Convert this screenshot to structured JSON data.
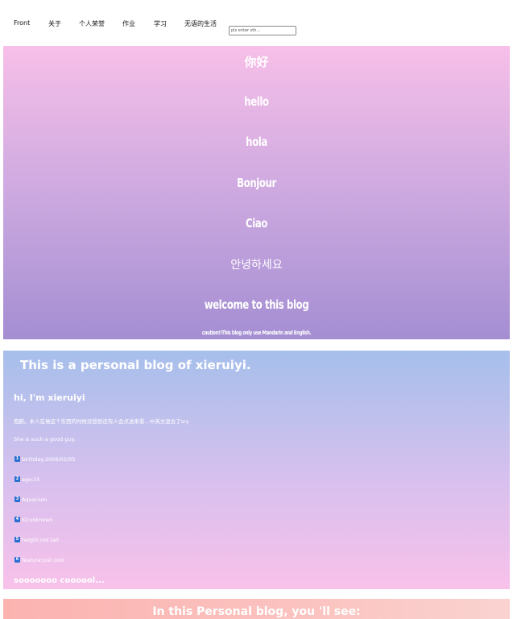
{
  "nav": {
    "items": [
      "Front",
      "关于",
      "个人荣誉",
      "作业",
      "学习",
      "无语的生活"
    ],
    "search_placeholder": "pls enter sth..."
  },
  "hero": {
    "greetings": [
      "你好",
      "hello",
      "hola",
      "Bonjour",
      "Ciao",
      "안녕하세요"
    ],
    "welcome": "welcome to this blog",
    "caution": "caution!!This blog only use Mandarin and English."
  },
  "intro": {
    "title": "This is a personal blog of xieruiyi.",
    "hi": "hi, I'm xieruiyi",
    "note": "抱歉。本人在做这个东西的时候没想到还有人会点进来看...中英文混合了sry",
    "line": "She is such a good guy.",
    "facts": [
      {
        "num": "1",
        "text": "birthday:2006/02/05"
      },
      {
        "num": "2",
        "text": "age:15"
      },
      {
        "num": "3",
        "text": "Aquarium"
      },
      {
        "num": "4",
        "text": "IQ:unknown"
      },
      {
        "num": "5",
        "text": "height:not tall"
      },
      {
        "num": "6",
        "text": "feature:just cool"
      }
    ],
    "cool": "sooooooo coooool..."
  },
  "banner": {
    "text": "In this Personal  blog, you 'll see:"
  },
  "colors": {
    "hero_top": "#f7bfe8",
    "hero_bottom": "#a48ed2",
    "intro_top": "#a6bfeb",
    "intro_bottom": "#f8c1ea",
    "banner": "#fbb3b0",
    "badge": "#2a6ecf"
  }
}
